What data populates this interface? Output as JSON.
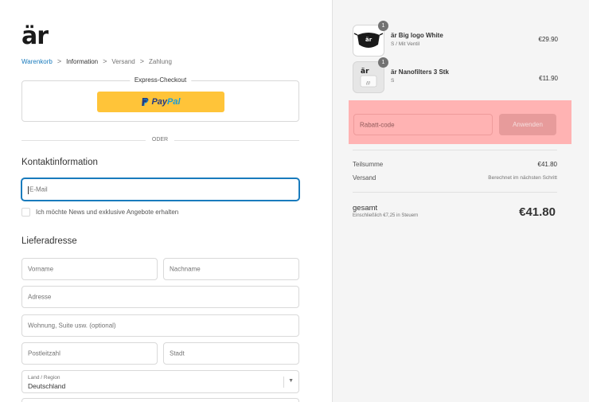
{
  "brand": {
    "logo": "är"
  },
  "breadcrumb": {
    "cart": "Warenkorb",
    "information": "Information",
    "shipping": "Versand",
    "payment": "Zahlung",
    "sep": ">"
  },
  "express": {
    "title": "Express-Checkout",
    "paypal_a": "Pay",
    "paypal_b": "Pal"
  },
  "divider_label": "ODER",
  "contact": {
    "title": "Kontaktinformation",
    "email_placeholder": "E-Mail",
    "newsletter_label": "Ich möchte News und exklusive Angebote erhalten"
  },
  "shipping": {
    "title": "Lieferadresse",
    "first_name": "Vorname",
    "last_name": "Nachname",
    "address": "Adresse",
    "apartment": "Wohnung, Suite usw. (optional)",
    "zip": "Postleitzahl",
    "city": "Stadt",
    "country_label": "Land / Region",
    "country_value": "Deutschland"
  },
  "cart": {
    "items": [
      {
        "name": "är Big logo White",
        "variant": "S / Mit Ventil",
        "price": "€29.90",
        "qty": "1",
        "icon": "mask-thumbnail"
      },
      {
        "name": "är Nanofilters 3 Stk",
        "variant": "S",
        "price": "€11.90",
        "qty": "1",
        "icon": "filter-thumbnail"
      }
    ],
    "discount_placeholder": "Rabatt-code",
    "apply_label": "Anwenden",
    "subtotal_label": "Teilsumme",
    "subtotal_value": "€41.80",
    "shipping_label": "Versand",
    "shipping_value": "Berechnet im nächsten Schritt",
    "total_label": "gesamt",
    "total_note": "Einschließlich €7,25 in Steuern",
    "total_value": "€41.80"
  },
  "colors": {
    "accent": "#197bbd",
    "paypal": "#ffc439",
    "discount_highlight": "#ffb3b3"
  }
}
